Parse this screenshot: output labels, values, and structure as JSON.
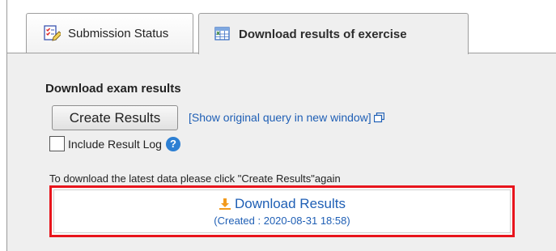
{
  "tabs": [
    {
      "label": "Submission Status",
      "icon": "checklist-pencil-icon"
    },
    {
      "label": "Download results of exercise",
      "icon": "spreadsheet-export-icon"
    }
  ],
  "panel": {
    "heading": "Download exam results",
    "create_button_label": "Create Results",
    "show_query_link": "[Show original query in new window]",
    "include_log_label": "Include Result Log",
    "include_log_checked": false,
    "help_icon_glyph": "?",
    "instruction": "To download the latest data please click \"Create Results\"again",
    "download_label": "Download Results",
    "created_text": "(Created : 2020-08-31 18:58)"
  },
  "colors": {
    "link": "#1f5fb5",
    "highlight_border": "#e8141c",
    "panel_bg": "#efefef",
    "download_icon": "#f29a1d",
    "help_icon": "#2d7fd3"
  }
}
